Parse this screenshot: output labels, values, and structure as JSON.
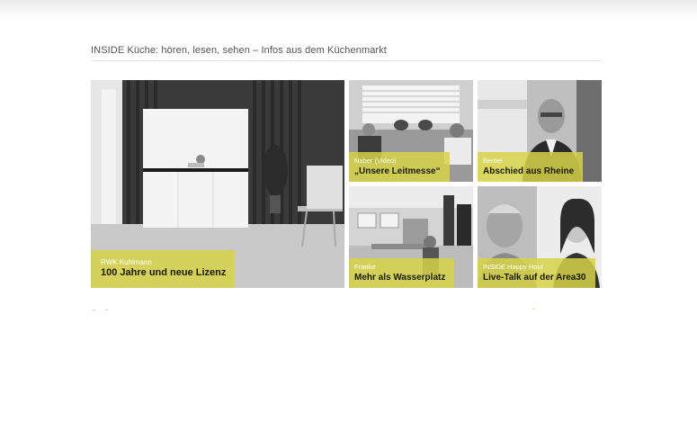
{
  "section": {
    "heading": "INSIDE Küche: hören, lesen, sehen – Infos aus dem Küchenmarkt"
  },
  "tiles": [
    {
      "kicker": "RWK Kuhlmann",
      "headline": "100 Jahre und neue Lizenz"
    },
    {
      "kicker": "Naber (Video)",
      "headline": "„Unsere Leitmesse“"
    },
    {
      "kicker": "Berbel",
      "headline": "Abschied aus Rheine"
    },
    {
      "kicker": "Franke",
      "headline": "Mehr als Wasserplatz"
    },
    {
      "kicker": "INSIDE Happy Hour",
      "headline": "Live-Talk auf der Area30"
    }
  ],
  "colors": {
    "caption_accent": "#d6d446",
    "headline_text": "#1a1a1a",
    "kicker_text": "#ffffff"
  }
}
